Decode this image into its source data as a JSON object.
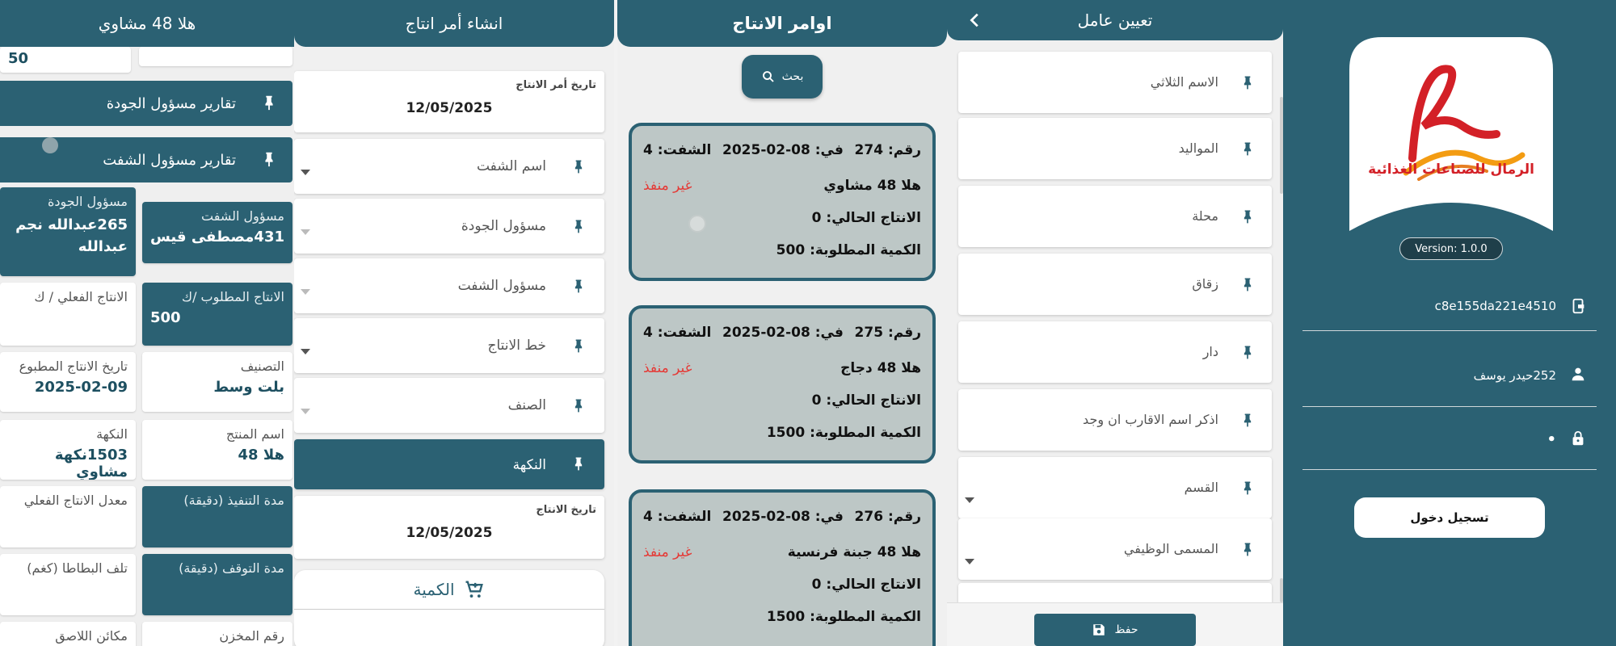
{
  "details": {
    "header": "هلا 48 مشاوي",
    "top_value": "50",
    "quality_reports_btn": "تقارير مسؤول الجودة",
    "shift_reports_btn": "تقارير مسؤول الشفت",
    "quality_manager": {
      "label": "مسؤول الجودة",
      "value": "265عبدالله نجم عبدالله"
    },
    "shift_manager": {
      "label": "مسؤول الشفت",
      "value": "431مصطفى قيس"
    },
    "actual_production": {
      "label": "الانتاج الفعلي / ك",
      "value": ""
    },
    "required_production": {
      "label": "الانتاج المطلوب /ك",
      "value": "500"
    },
    "printed_date": {
      "label": "تاريخ الانتاج المطبوع",
      "value": "2025-02-09"
    },
    "classification": {
      "label": "التصنيف",
      "value": "بلت وسط"
    },
    "flavor": {
      "label": "النكهة",
      "value": "1503نكهة مشاوي"
    },
    "product_name": {
      "label": "اسم المنتج",
      "value": "هلا 48"
    },
    "actual_rate": {
      "label": "معدل الانتاج الفعلي",
      "value": ""
    },
    "exec_duration": {
      "label": "مدة التنفيذ (دقيقة)",
      "value": ""
    },
    "potato_waste": {
      "label": "تلف البطاطا (كغم)",
      "value": ""
    },
    "stop_duration": {
      "label": "مدة التوقف (دقيقة)",
      "value": ""
    },
    "adhesive_machines": {
      "label": "مكائن اللاصق",
      "value": ""
    },
    "warehouse_no": {
      "label": "رقم المخزن",
      "value": ""
    }
  },
  "create_order": {
    "header": "انشاء أمر انتاج",
    "order_date": {
      "label": "تاريخ أمر الانتاج",
      "value": "12/05/2025"
    },
    "fields": [
      "اسم الشفت",
      "مسؤول الجودة",
      "مسؤول الشفت",
      "خط الانتاج",
      "الصنف"
    ],
    "flavor_btn": "النكهة",
    "production_date": {
      "label": "تاريخ الانتاج",
      "value": "12/05/2025"
    },
    "quantity_label": "الكمية"
  },
  "orders": {
    "header": "اوامر الانتاج",
    "search_label": "بحث",
    "items": [
      {
        "number": "رقم: 274",
        "date": "في: 08-02-2025",
        "shift": "الشفت: 4",
        "product": "هلا 48 مشاوي",
        "status": "غير منفذ",
        "current": "الانتاج الحالي: 0",
        "required": "الكمية المطلوبة: 500"
      },
      {
        "number": "رقم: 275",
        "date": "في: 08-02-2025",
        "shift": "الشفت: 4",
        "product": "هلا 48 دجاج",
        "status": "غير منفذ",
        "current": "الانتاج الحالي: 0",
        "required": "الكمية المطلوبة: 1500"
      },
      {
        "number": "رقم: 276",
        "date": "في: 08-02-2025",
        "shift": "الشفت: 4",
        "product": "هلا 48 جبنة فرنسية",
        "status": "غير منفذ",
        "current": "الانتاج الحالي: 0",
        "required": "الكمية المطلوبة: 1500"
      }
    ]
  },
  "assign_worker": {
    "header": "تعيين عامل",
    "fields": [
      "الاسم الثلاثي",
      "المواليد",
      "محلة",
      "زقاق",
      "دار",
      "اذكر اسم الاقارب ان وجد",
      "القسم",
      "المسمى الوظيفي"
    ],
    "save_label": "حفظ"
  },
  "login": {
    "brand_text": "الرمال للصناعات الغذائية",
    "version": "Version: 1.0.0",
    "device_id": "c8e155da221e4510",
    "user": "252حيدر يوسف",
    "password": "•",
    "login_label": "تسجيل دخول"
  },
  "colors": {
    "primary": "#2b6173",
    "status_red": "#e53935",
    "card_bg": "#bdc7c6",
    "logo_red": "#d32027",
    "logo_orange": "#f39c12"
  }
}
